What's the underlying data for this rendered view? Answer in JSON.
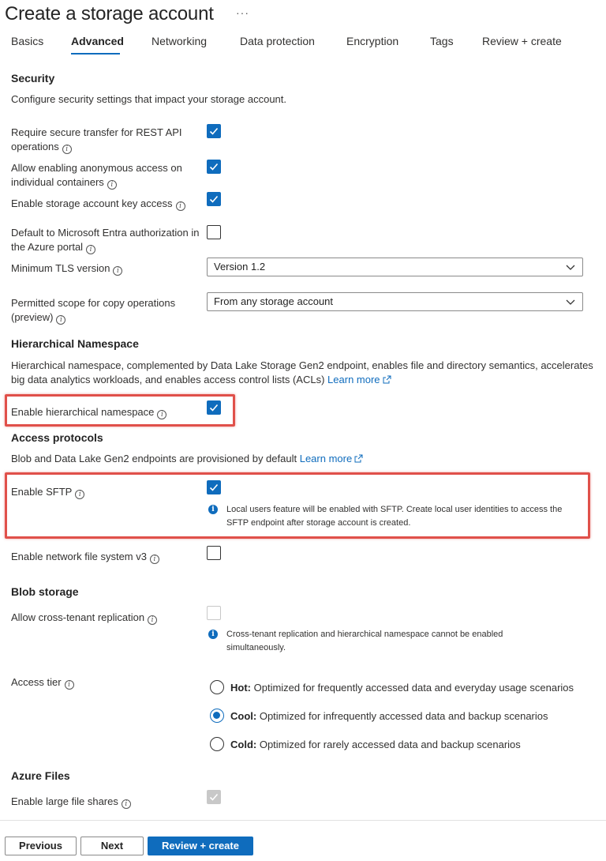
{
  "page": {
    "title": "Create a storage account",
    "more_label": "···"
  },
  "tabs": [
    {
      "label": "Basics"
    },
    {
      "label": "Advanced",
      "active": true
    },
    {
      "label": "Networking"
    },
    {
      "label": "Data protection"
    },
    {
      "label": "Encryption"
    },
    {
      "label": "Tags"
    },
    {
      "label": "Review + create"
    }
  ],
  "security": {
    "heading": "Security",
    "description": "Configure security settings that impact your storage account.",
    "secure_transfer": {
      "label_line1": "Require secure transfer for REST API",
      "label_line2": "operations",
      "checked": true
    },
    "anonymous_access": {
      "label_line1": "Allow enabling anonymous access on",
      "label_line2": "individual containers",
      "checked": true
    },
    "key_access": {
      "label": "Enable storage account key access",
      "checked": true
    },
    "entra_default": {
      "label_line1": "Default to Microsoft Entra authorization in",
      "label_line2": "the Azure portal",
      "checked": false
    },
    "tls": {
      "label": "Minimum TLS version",
      "value": "Version 1.2"
    },
    "copy_scope": {
      "label_line1": "Permitted scope for copy operations",
      "label_line2": "(preview)",
      "value": "From any storage account"
    }
  },
  "hns": {
    "heading": "Hierarchical Namespace",
    "description_line1": "Hierarchical namespace, complemented by Data Lake Storage Gen2 endpoint, enables file and directory semantics, accelerates",
    "description_line2": "big data analytics workloads, and enables access control lists (ACLs)",
    "learn_more": "Learn more",
    "enable": {
      "label": "Enable hierarchical namespace",
      "checked": true
    }
  },
  "access_protocols": {
    "heading": "Access protocols",
    "description": "Blob and Data Lake Gen2 endpoints are provisioned by default",
    "learn_more": "Learn more",
    "sftp": {
      "label": "Enable SFTP",
      "checked": true,
      "callout_line1": "Local users feature will be enabled with SFTP. Create local user identities to access the",
      "callout_line2": "SFTP endpoint after storage account is created."
    },
    "nfs": {
      "label": "Enable network file system v3",
      "checked": false
    }
  },
  "blob": {
    "heading": "Blob storage",
    "cross_tenant": {
      "label": "Allow cross-tenant replication",
      "checked": false,
      "disabled": true,
      "callout_line1": "Cross-tenant replication and hierarchical namespace cannot be enabled",
      "callout_line2": "simultaneously."
    },
    "access_tier": {
      "label": "Access tier",
      "options": [
        {
          "name": "Hot:",
          "desc": "Optimized for frequently accessed data and everyday usage scenarios",
          "selected": false
        },
        {
          "name": "Cool:",
          "desc": "Optimized for infrequently accessed data and backup scenarios",
          "selected": true
        },
        {
          "name": "Cold:",
          "desc": "Optimized for rarely accessed data and backup scenarios",
          "selected": false
        }
      ]
    }
  },
  "files": {
    "heading": "Azure Files",
    "large_shares": {
      "label": "Enable large file shares",
      "checked": true,
      "disabled": true
    }
  },
  "footer": {
    "previous": "Previous",
    "next": "Next",
    "review_create": "Review + create"
  },
  "colors": {
    "accent": "#0f6cbd",
    "highlight": "#e0504a"
  }
}
